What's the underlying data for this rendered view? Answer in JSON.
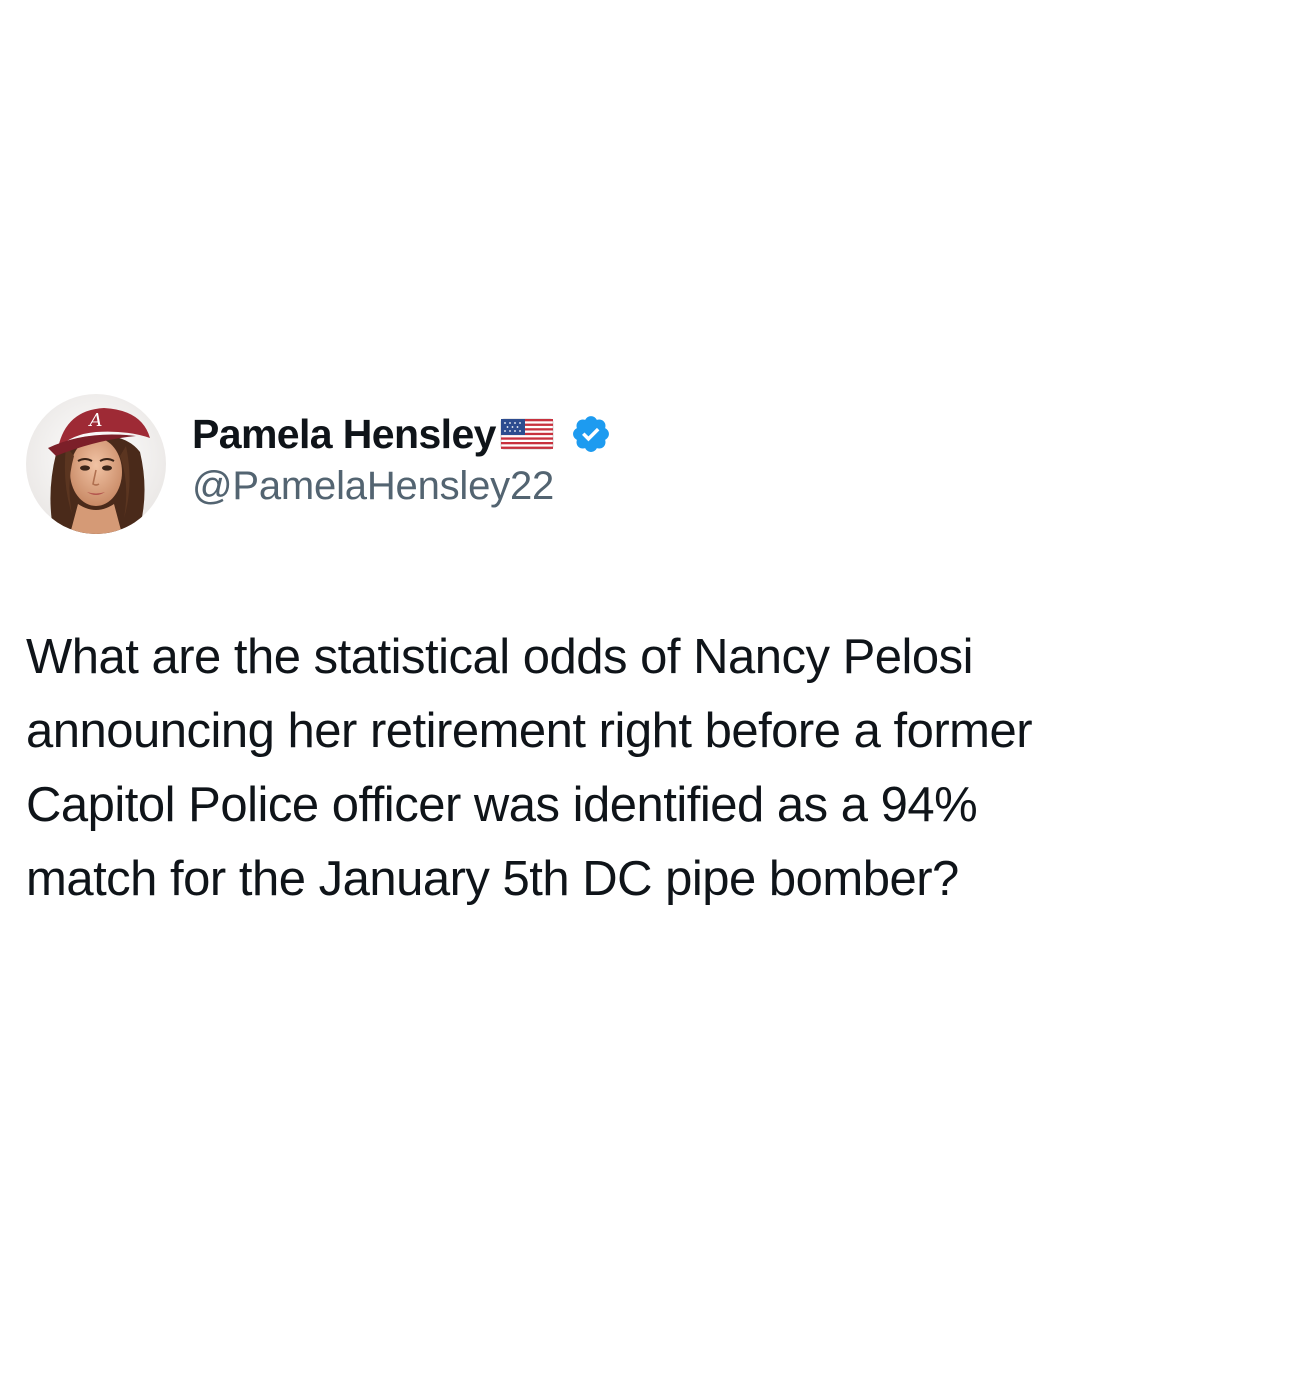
{
  "author": {
    "display_name": "Pamela Hensley",
    "flag_emoji_name": "us-flag-icon",
    "verified_icon": "verified-badge-icon",
    "handle": "@PamelaHensley22",
    "avatar_icon": "profile-avatar",
    "brand_color": "#1d9bf0",
    "handle_color": "#536471"
  },
  "tweet": {
    "lines": [
      "What are the statistical odds of Nancy Pelosi",
      "announcing her retirement right before a former",
      "Capitol Police officer was identified as a 94%",
      "match for the January 5th DC pipe bomber?"
    ]
  }
}
